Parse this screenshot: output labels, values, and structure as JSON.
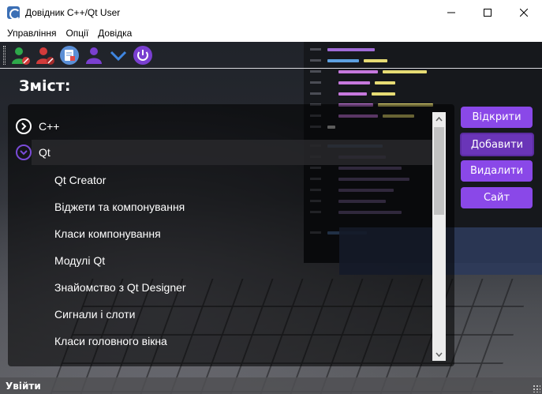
{
  "window": {
    "title": "Довідник С++/Qt User",
    "controls": [
      "minimize-icon",
      "maximize-icon",
      "close-icon"
    ]
  },
  "menu": {
    "items": [
      "Управління",
      "Опції",
      "Довідка"
    ]
  },
  "toolbar": {
    "buttons": [
      {
        "icon": "user-add-icon"
      },
      {
        "icon": "user-remove-icon"
      },
      {
        "icon": "edit-document-icon"
      },
      {
        "icon": "user-icon"
      },
      {
        "icon": "chevron-down-icon"
      },
      {
        "icon": "power-icon"
      }
    ]
  },
  "content": {
    "title": "Зміст:"
  },
  "tree": {
    "items": [
      {
        "label": "С++",
        "level": 0,
        "expanded": false
      },
      {
        "label": "Qt",
        "level": 0,
        "expanded": true,
        "selected": true
      },
      {
        "label": "Qt Creator",
        "level": 1
      },
      {
        "label": "Віджети та компонування",
        "level": 1
      },
      {
        "label": "Класи компонування",
        "level": 1
      },
      {
        "label": "Модулі Qt",
        "level": 1
      },
      {
        "label": "Знайомство з Qt Designer",
        "level": 1
      },
      {
        "label": "Сигнали і слоти",
        "level": 1
      },
      {
        "label": "Класи головного вікна",
        "level": 1
      }
    ]
  },
  "actions": {
    "open": "Відкрити",
    "add": "Добавити",
    "delete": "Видалити",
    "site": "Сайт"
  },
  "status": {
    "text": "Увійти"
  },
  "colors": {
    "accent": "#8a48e8",
    "accent_active": "#6a35b8",
    "icon_green": "#2ea84a",
    "icon_red": "#d23b3b",
    "icon_purple": "#7a3fd0",
    "icon_blue": "#3f86e0"
  }
}
